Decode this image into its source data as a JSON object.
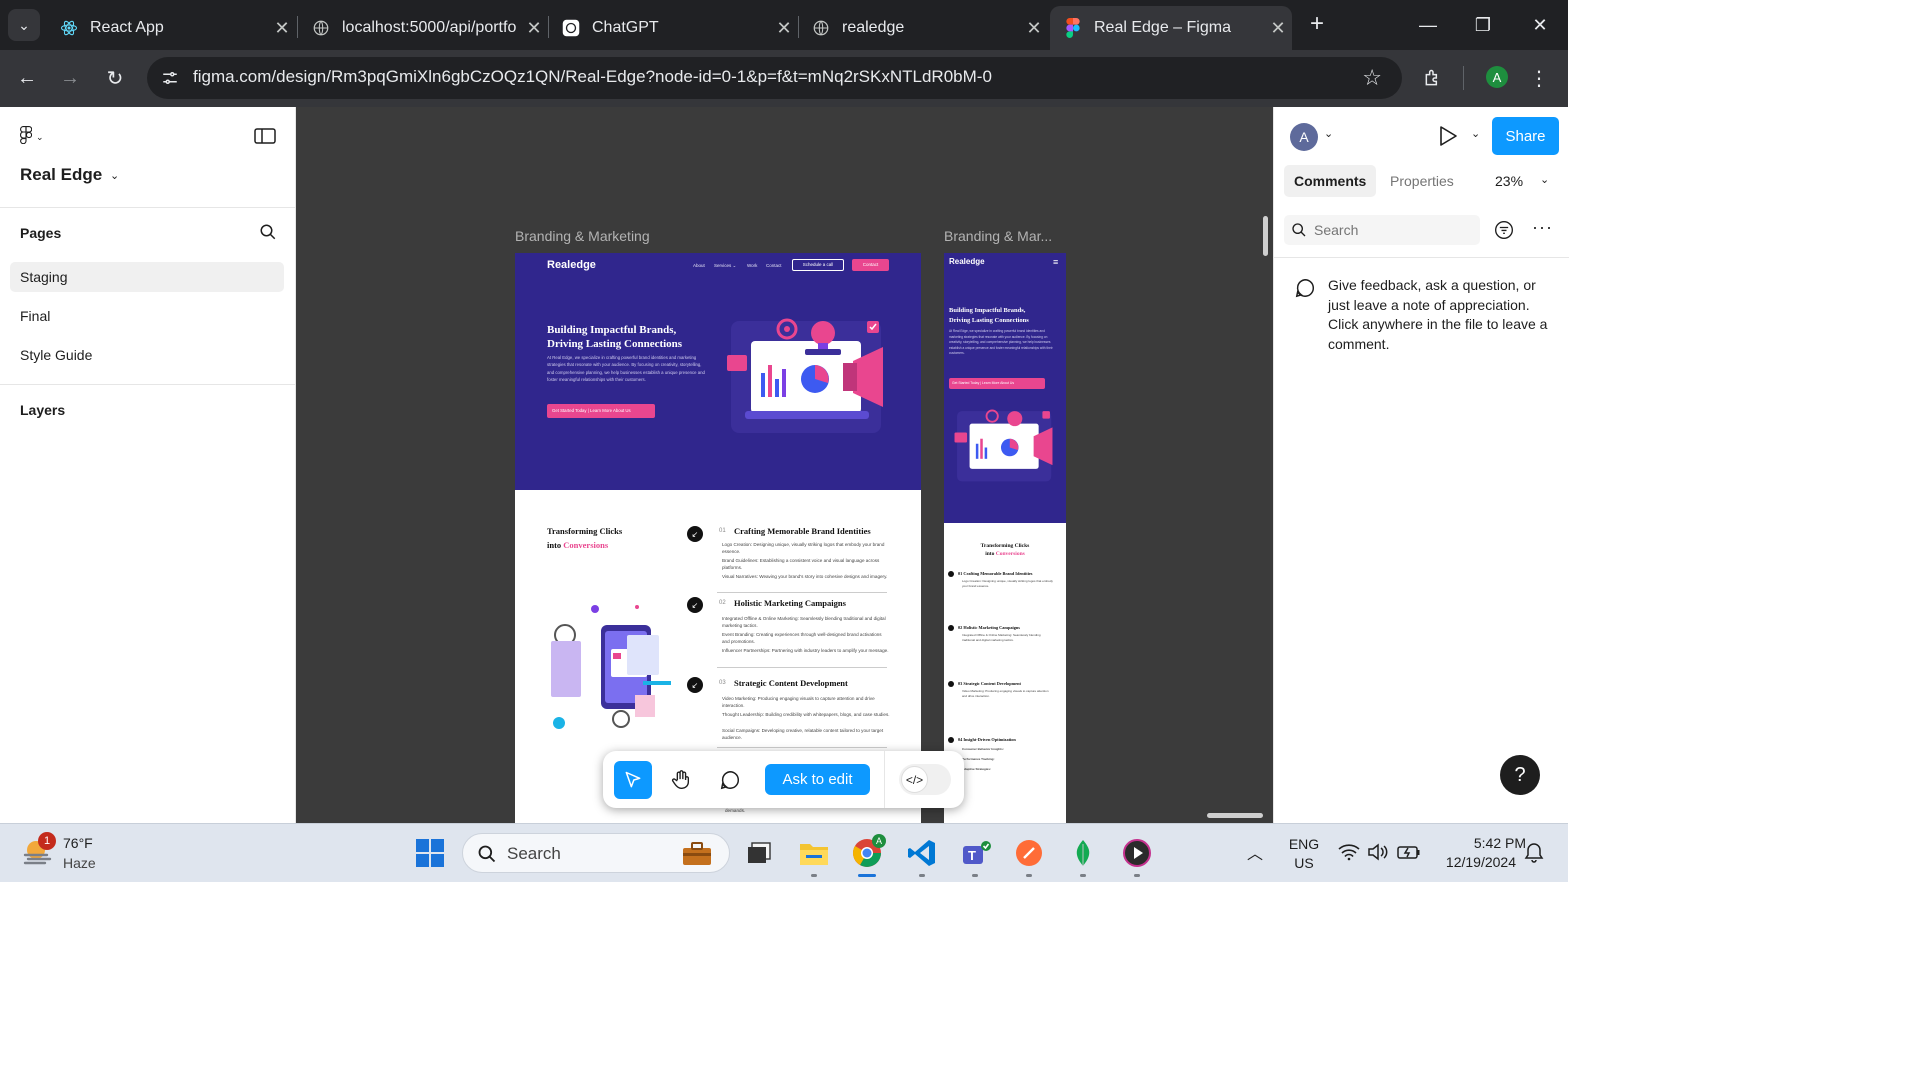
{
  "browser": {
    "tabs": [
      {
        "label": "React App",
        "icon": "react-icon"
      },
      {
        "label": "localhost:5000/api/portfo",
        "icon": "globe-icon"
      },
      {
        "label": "ChatGPT",
        "icon": "chatgpt-icon"
      },
      {
        "label": "realedge",
        "icon": "globe-icon"
      },
      {
        "label": "Real Edge – Figma",
        "icon": "figma-icon",
        "active": true
      }
    ],
    "url": "figma.com/design/Rm3pqGmiXln6gbCzOQz1QN/Real-Edge?node-id=0-1&p=f&t=mNq2rSKxNTLdR0bM-0",
    "profile_initial": "A"
  },
  "left_panel": {
    "file_name": "Real Edge",
    "pages_title": "Pages",
    "pages": [
      "Staging",
      "Final",
      "Style Guide"
    ],
    "active_page": "Staging",
    "layers_title": "Layers"
  },
  "canvas": {
    "frames": [
      {
        "label": "Branding & Marketing"
      },
      {
        "label": "Branding & Mar..."
      }
    ],
    "desktop": {
      "logo": "Realedge",
      "nav": [
        "About",
        "Services ⌄",
        "Work",
        "Contact"
      ],
      "schedule_btn": "Schedule a call",
      "contact_btn": "Contact",
      "hero_title_1": "Building Impactful Brands,",
      "hero_title_2": "Driving Lasting Connections",
      "hero_text": "At Real Edge, we specialize in crafting powerful brand identities and marketing strategies that resonate with your audience. By focusing on creativity, storytelling, and comprehensive planning, we help businesses establish a unique presence and foster meaningful relationships with their customers.",
      "hero_cta": "Get Started Today | Learn More About Us",
      "transform_title_1": "Transforming Clicks",
      "transform_title_2": "into",
      "transform_highlight": "Conversions",
      "services": [
        {
          "num": "01",
          "title": "Crafting Memorable Brand Identities",
          "bullets": [
            "Logo Creation: Designing unique, visually striking logos that embody your brand essence.",
            "Brand Guidelines: Establishing a consistent voice and visual language across platforms.",
            "Visual Narratives: Weaving your brand's story into cohesive designs and imagery."
          ]
        },
        {
          "num": "02",
          "title": "Holistic Marketing Campaigns",
          "bullets": [
            "Integrated Offline & Online Marketing: Seamlessly blending traditional and digital marketing tactics.",
            "Event Branding: Creating experiences through well-designed brand activations and promotions.",
            "Influencer Partnerships: Partnering with industry leaders to amplify your message."
          ]
        },
        {
          "num": "03",
          "title": "Strategic Content Development",
          "bullets": [
            "Video Marketing: Producing engaging visuals to capture attention and drive interaction.",
            "Thought Leadership: Building credibility with whitepapers, blogs, and case studies.",
            "Social Campaigns: Developing creative, relatable content tailored to your target audience."
          ]
        }
      ],
      "trailing_text": "demands."
    },
    "mobile": {
      "logo": "Realedge",
      "services": [
        "01 Crafting Memorable Brand Identities",
        "02 Holistic Marketing Campaigns",
        "03 Strategic Content Development",
        "04 Insight-Driven Optimization"
      ],
      "bullet_labels_4": [
        "Consumer Behavior Insights:",
        "Performance Tracking:",
        "Adaptive Strategies:"
      ]
    }
  },
  "toolbar": {
    "ask_label": "Ask to edit",
    "dev_icon": "</>"
  },
  "right_panel": {
    "avatar_initial": "A",
    "share_label": "Share",
    "tabs": [
      "Comments",
      "Properties"
    ],
    "zoom": "23%",
    "search_placeholder": "Search",
    "hint": "Give feedback, ask a question, or just leave a note of appreciation. Click anywhere in the file to leave a comment.",
    "help": "?"
  },
  "taskbar": {
    "weather_temp": "76°F",
    "weather_desc": "Haze",
    "weather_badge": "1",
    "search_label": "Search",
    "lang_1": "ENG",
    "lang_2": "US",
    "time": "5:42 PM",
    "date": "12/19/2024"
  }
}
